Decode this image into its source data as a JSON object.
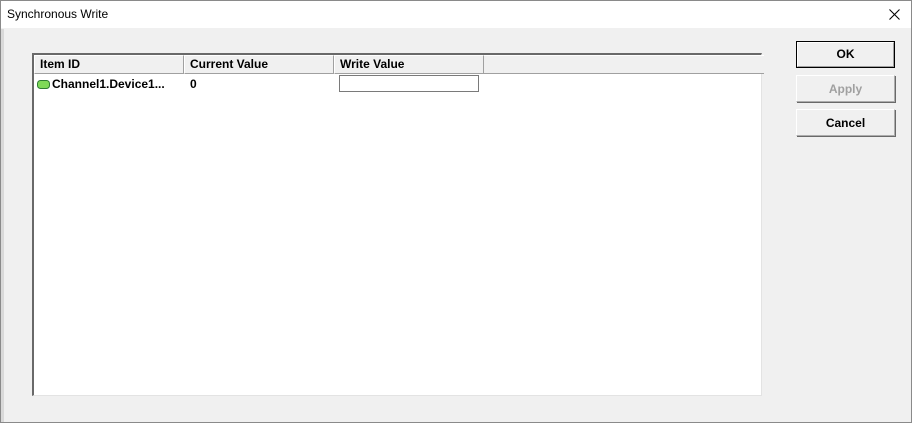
{
  "window": {
    "title": "Synchronous Write"
  },
  "icons": {
    "close": "close-icon",
    "tag": "tag-icon"
  },
  "colors": {
    "tag_icon_fill": "#7ed957",
    "tag_icon_stroke": "#2e7d32",
    "disabled_text": "#a0a0a0"
  },
  "list": {
    "columns": [
      "Item ID",
      "Current Value",
      "Write Value"
    ],
    "rows": [
      {
        "item_id": "Channel1.Device1...",
        "current_value": "0",
        "write_value": ""
      }
    ]
  },
  "buttons": {
    "ok": "OK",
    "apply": "Apply",
    "cancel": "Cancel"
  }
}
